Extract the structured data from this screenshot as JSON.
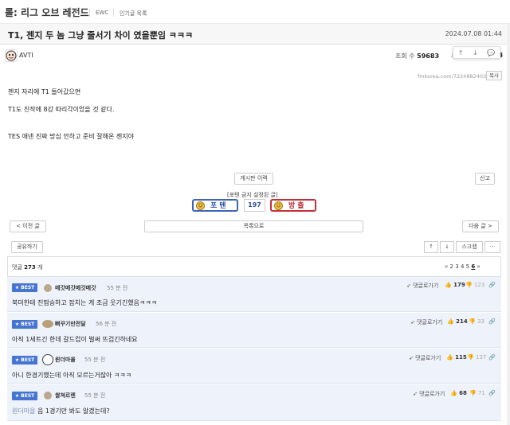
{
  "board": {
    "title": "롤: 리그 오브 레전드",
    "crumbs": [
      "EWC",
      "인기글 목록"
    ]
  },
  "post": {
    "title": "T1, 젠지 두 놈 그냥 줄서기 차이 였을뿐임 ㅋㅋㅋ",
    "date": "2024.07.08 01:44",
    "author": "AVTI",
    "views_label": "조회 수",
    "views": "59683",
    "reco_label": "추천",
    "reco": "73",
    "source": "fmkorea.com/7224882403",
    "copy_label": "복사",
    "lines": [
      "젠지 자리에 T1 들어갔으면",
      "T1도 진작에 8강 따리각이었을 것 같다.",
      "TES 애넨 진짜 방심 안하고 준비 잘해온 젠지야"
    ]
  },
  "actions": {
    "history": "게시판 이력",
    "report": "신고",
    "poten_caption": "[포텐 금지 설정된 글]",
    "vote_up": "포텐",
    "vote_down": "방출",
    "vote_count": "197",
    "prev": "< 이전 글",
    "list": "목록으로",
    "next": "다음 글 >",
    "share": "공유하기",
    "scrap": "스크랩",
    "more": "···"
  },
  "comments_head": {
    "label": "댓글",
    "count": "273",
    "unit": "개",
    "pages": [
      "«",
      "2",
      "3",
      "4",
      "5",
      "6",
      "»"
    ],
    "current": "6"
  },
  "comments": [
    {
      "badge": "★ BEST",
      "nick": "메갓메갓메갓메갓",
      "ago": "55 분 전",
      "reply": "댓글로가기",
      "up": "179",
      "down": "123",
      "text": "북미한테 진땀승하고 잡치는 게 조금 웃기긴했음ㅋㅋㅋ",
      "mention": ""
    },
    {
      "badge": "★ BEST",
      "nick": "뻐꾸기만전달",
      "ago": "56 분 전",
      "reply": "댓글로가기",
      "up": "214",
      "down": "33",
      "text": "아직 1세트긴 한데 갈드컵이 벌써 뜨겁긴하네요",
      "mention": ""
    },
    {
      "badge": "★ BEST",
      "nick": "윈더마을",
      "ago": "55 분 전",
      "reply": "댓글로가기",
      "up": "115",
      "down": "137",
      "text": "아니 한경기했는데 아직 모르는거잖아 ㅋㅋㅋ",
      "mention": ""
    },
    {
      "badge": "★ BEST",
      "nick": "쌀쳐르렌",
      "ago": "55 분 전",
      "reply": "댓글로가기",
      "up": "68",
      "down": "71",
      "text": "음 1경기만 봐도 알겠는데?",
      "mention": "윈더마을"
    }
  ],
  "icons": {
    "star": "star-icon",
    "up": "arrow-up-icon",
    "down": "arrow-down-icon",
    "comment": "comment-icon",
    "thumb": "thumb-up-icon",
    "thumbdown": "thumb-down-icon",
    "link": "link-icon"
  },
  "colors": {
    "best_badge": "#4674d1",
    "vote_up": "#3f63b5",
    "vote_down": "#c2303a",
    "comment_bg": "#eef2fb"
  }
}
